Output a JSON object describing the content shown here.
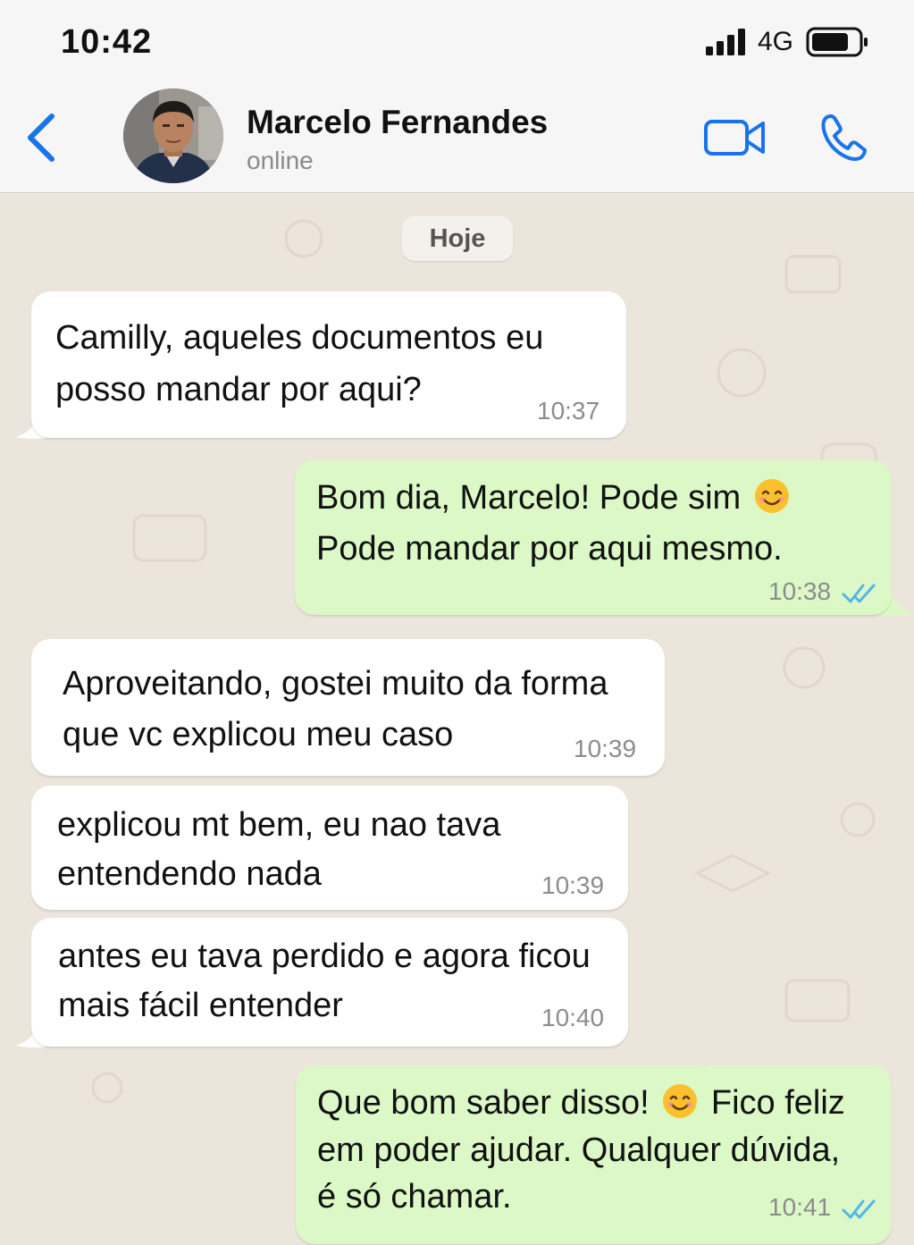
{
  "status_bar": {
    "time": "10:42",
    "network": "4G",
    "icons": [
      "signal-bars-icon",
      "battery-icon"
    ]
  },
  "header": {
    "contact_name": "Marcelo Fernandes",
    "contact_status": "online",
    "icons": [
      "back-chevron-icon",
      "video-call-icon",
      "phone-call-icon"
    ],
    "accent_color": "#1a73e8"
  },
  "chat": {
    "date_label": "Hoje",
    "messages": [
      {
        "direction": "in",
        "lines": [
          "Camilly, aqueles documentos eu",
          "posso mandar por aqui?"
        ],
        "time": "10:37"
      },
      {
        "direction": "out",
        "line1_text": "Bom dia, Marcelo! Pode sim",
        "line2": "Pode mandar por aqui mesmo.",
        "time": "10:38",
        "read": true
      },
      {
        "direction": "in",
        "lines": [
          "Aproveitando, gostei muito da forma",
          "que vc explicou meu caso"
        ],
        "time": "10:39"
      },
      {
        "direction": "in",
        "lines": [
          "explicou mt bem, eu nao tava",
          "entendendo nada"
        ],
        "time": "10:39"
      },
      {
        "direction": "in",
        "lines": [
          "antes eu tava perdido e agora ficou",
          "mais fácil entender"
        ],
        "time": "10:40"
      },
      {
        "direction": "out",
        "line1_before": "Que bom saber disso!",
        "line1_after": "Fico feliz",
        "line2": "em poder ajudar. Qualquer dúvida,",
        "line3": "é só chamar.",
        "time": "10:41",
        "read": true
      }
    ],
    "colors": {
      "incoming_bubble": "#ffffff",
      "outgoing_bubble": "#dcf8c6",
      "read_ticks": "#4fb6ec",
      "background": "#ece5dc"
    }
  }
}
